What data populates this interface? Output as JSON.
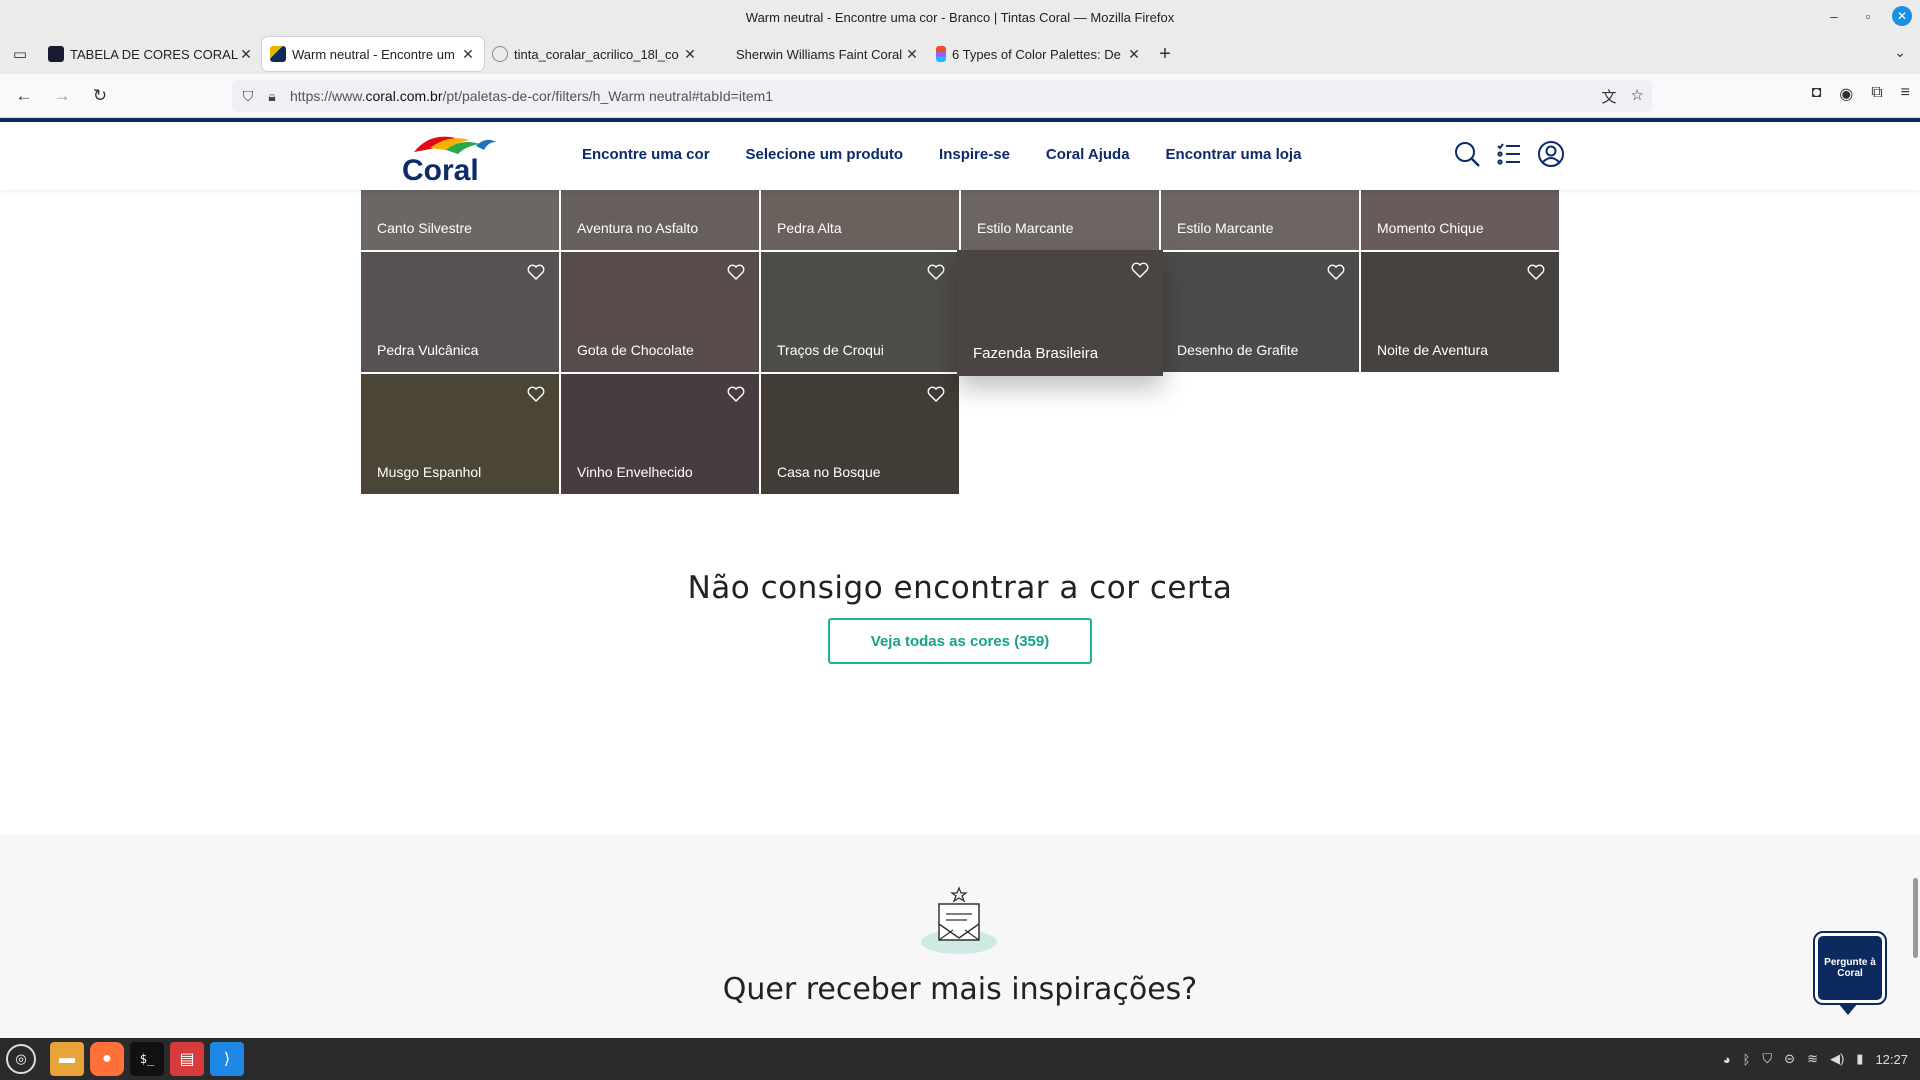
{
  "window": {
    "title": "Warm neutral - Encontre uma cor - Branco | Tintas Coral — Mozilla Firefox"
  },
  "tabs": [
    {
      "title": "TABELA DE CORES CORAL –",
      "favicon_color": "#1a1a2e",
      "active": false
    },
    {
      "title": "Warm neutral - Encontre um",
      "favicon_color": "#0d2a5f",
      "active": true
    },
    {
      "title": "tinta_coralar_acrilico_18l_co",
      "favicon_color": "#888888",
      "active": false
    },
    {
      "title": "Sherwin Williams Faint Coral",
      "favicon_color": "#ffffff",
      "active": false
    },
    {
      "title": "6 Types of Color Palettes: De",
      "favicon_color": "#e74c3c",
      "active": false
    }
  ],
  "urlbar": {
    "url_prefix": "https://www.",
    "url_domain": "coral.com.br",
    "url_path": "/pt/paletas-de-cor/filters/h_Warm neutral#tabId=item1"
  },
  "site": {
    "brand": "Coral",
    "nav": [
      "Encontre uma cor",
      "Selecione um produto",
      "Inspire-se",
      "Coral Ajuda",
      "Encontrar uma loja"
    ]
  },
  "swatches_row1": [
    {
      "name": "Canto Silvestre",
      "color": "#6c6664"
    },
    {
      "name": "Aventura no Asfalto",
      "color": "#665f5e"
    },
    {
      "name": "Pedra Alta",
      "color": "#6a605c"
    },
    {
      "name": "Estilo Marcante",
      "color": "#6d6564"
    },
    {
      "name": "Estilo Marcante",
      "color": "#6d6564"
    },
    {
      "name": "Momento Chique",
      "color": "#675b5c"
    }
  ],
  "swatches_row2": [
    {
      "name": "Pedra Vulcânica",
      "color": "#575251"
    },
    {
      "name": "Gota de Chocolate",
      "color": "#574b4c"
    },
    {
      "name": "Traços de Croqui",
      "color": "#4f4d4a"
    },
    {
      "name": "Fazenda Brasileira",
      "color": "#4a4542"
    },
    {
      "name": "Desenho de Grafite",
      "color": "#4b4b4b"
    },
    {
      "name": "Noite de Aventura",
      "color": "#464240"
    }
  ],
  "swatches_row3": [
    {
      "name": "Musgo Espanhol",
      "color": "#4b4536"
    },
    {
      "name": "Vinho Envelhecido",
      "color": "#473d41"
    },
    {
      "name": "Casa no Bosque",
      "color": "#423c36"
    }
  ],
  "cta": {
    "title": "Não consigo encontrar a cor certa",
    "button": "Veja todas as cores (359)"
  },
  "newsletter": {
    "title": "Quer receber mais inspirações?"
  },
  "ask_coral": {
    "label": "Pergunte à Coral"
  },
  "taskbar": {
    "time": "12:27"
  }
}
